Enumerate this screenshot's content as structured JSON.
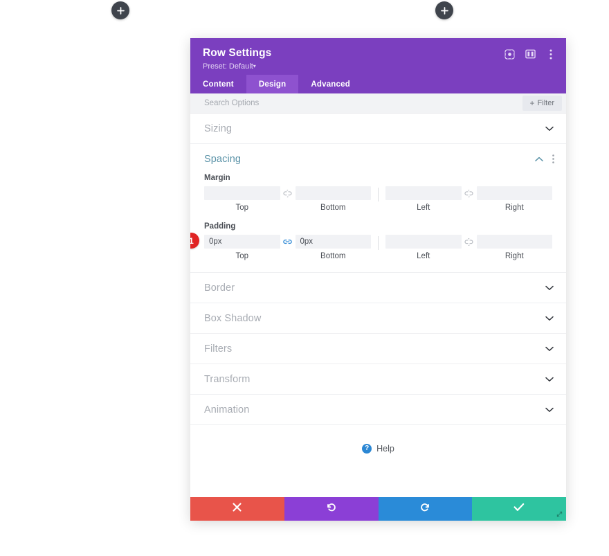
{
  "canvas": {
    "add_buttons": [
      {
        "name": "add-section-left",
        "label": "+"
      },
      {
        "name": "add-section-right",
        "label": "+"
      }
    ]
  },
  "modal": {
    "title": "Row Settings",
    "preset_label": "Preset: Default",
    "preset_caret": "▾",
    "header_icons": [
      {
        "name": "focus-icon",
        "title": "focus"
      },
      {
        "name": "layout-columns-icon",
        "title": "layout"
      },
      {
        "name": "more-vertical-icon",
        "title": "more"
      }
    ],
    "tabs": [
      {
        "label": "Content",
        "active": false
      },
      {
        "label": "Design",
        "active": true
      },
      {
        "label": "Advanced",
        "active": false
      }
    ],
    "search": {
      "value": "",
      "placeholder": "Search Options"
    },
    "filter_button": {
      "plus": "+",
      "label": "Filter"
    },
    "sections": [
      {
        "name": "sizing",
        "title": "Sizing",
        "open": false
      },
      {
        "name": "spacing",
        "title": "Spacing",
        "open": true
      },
      {
        "name": "border",
        "title": "Border",
        "open": false
      },
      {
        "name": "box-shadow",
        "title": "Box Shadow",
        "open": false
      },
      {
        "name": "filters",
        "title": "Filters",
        "open": false
      },
      {
        "name": "transform",
        "title": "Transform",
        "open": false
      },
      {
        "name": "animation",
        "title": "Animation",
        "open": false
      }
    ],
    "spacing": {
      "margin": {
        "label": "Margin",
        "top": {
          "value": "",
          "caption": "Top"
        },
        "bottom": {
          "value": "",
          "caption": "Bottom"
        },
        "left": {
          "value": "",
          "caption": "Left"
        },
        "right": {
          "value": "",
          "caption": "Right"
        },
        "link_tb_state": "unlinked",
        "link_lr_state": "unlinked"
      },
      "padding": {
        "label": "Padding",
        "top": {
          "value": "0px",
          "caption": "Top"
        },
        "bottom": {
          "value": "0px",
          "caption": "Bottom"
        },
        "left": {
          "value": "",
          "caption": "Left"
        },
        "right": {
          "value": "",
          "caption": "Right"
        },
        "link_tb_state": "linked",
        "link_lr_state": "unlinked",
        "step_badge": "1"
      }
    },
    "help": {
      "icon_glyph": "?",
      "label": "Help"
    },
    "footer": [
      {
        "name": "discard-button",
        "icon": "close-icon",
        "glyph": "✖",
        "color": "#e8544a"
      },
      {
        "name": "undo-button",
        "icon": "undo-icon",
        "glyph": "↺",
        "color": "#8b3fd6"
      },
      {
        "name": "redo-button",
        "icon": "redo-icon",
        "glyph": "↻",
        "color": "#2a8bd8"
      },
      {
        "name": "save-button",
        "icon": "checkmark-icon",
        "glyph": "✔",
        "color": "#2ec4a0"
      }
    ]
  },
  "colors": {
    "header_purple": "#7b3fbf",
    "tab_active": "#8e52cf",
    "section_open_accent": "#5b93a8",
    "badge_red": "#e02424",
    "link_active_blue": "#2b87d4"
  }
}
